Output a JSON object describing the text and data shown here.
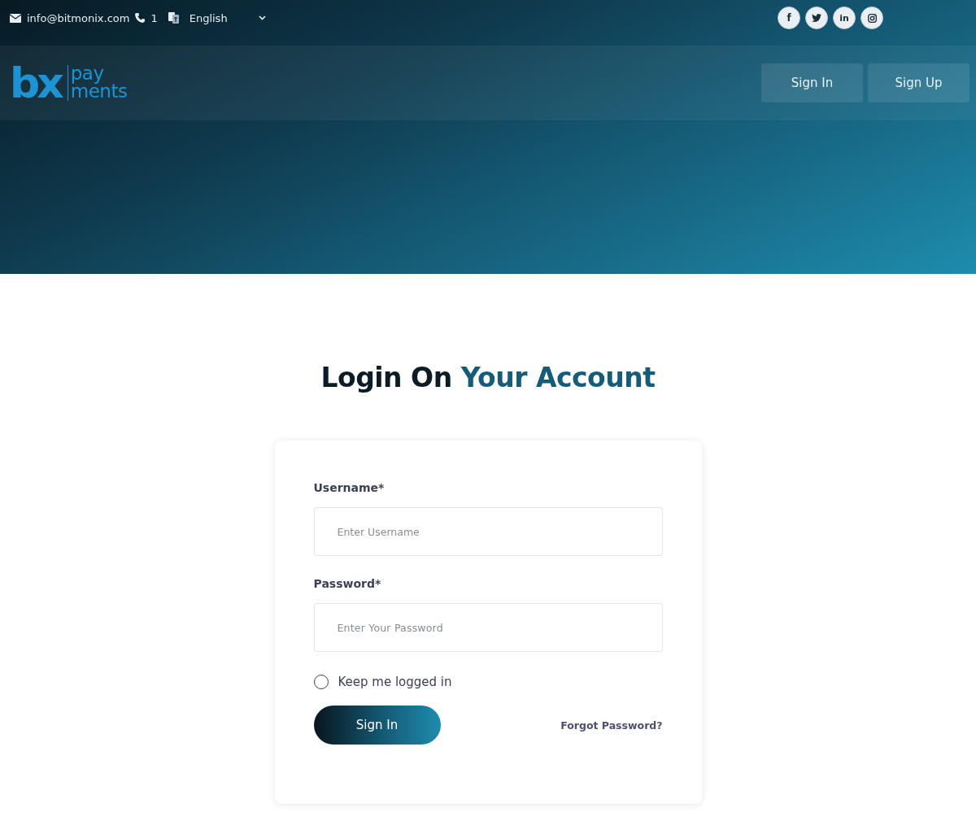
{
  "topbar": {
    "email": "info@bitmonix.com",
    "phone": "1",
    "language": "English",
    "social": [
      {
        "kind": "facebook",
        "glyph": "f"
      },
      {
        "kind": "twitter"
      },
      {
        "kind": "linkedin",
        "glyph": "in"
      },
      {
        "kind": "instagram"
      }
    ]
  },
  "logo": {
    "mark": "bx",
    "line_1": "pay",
    "line_2": "ments"
  },
  "nav_buttons": [
    "Sign In",
    "Sign Up"
  ],
  "heading": {
    "lead": "Login On",
    "accent": "Your Account"
  },
  "form": {
    "fields": [
      {
        "label": "Username*",
        "placeholder": "Enter Username",
        "kind": "plain"
      },
      {
        "label": "Password*",
        "placeholder": "Enter Your Password",
        "kind": "password"
      }
    ],
    "remember": {
      "label": "Keep me logged in",
      "checked": false
    },
    "submit": "Sign In",
    "forgot": "Forgot Password?"
  }
}
